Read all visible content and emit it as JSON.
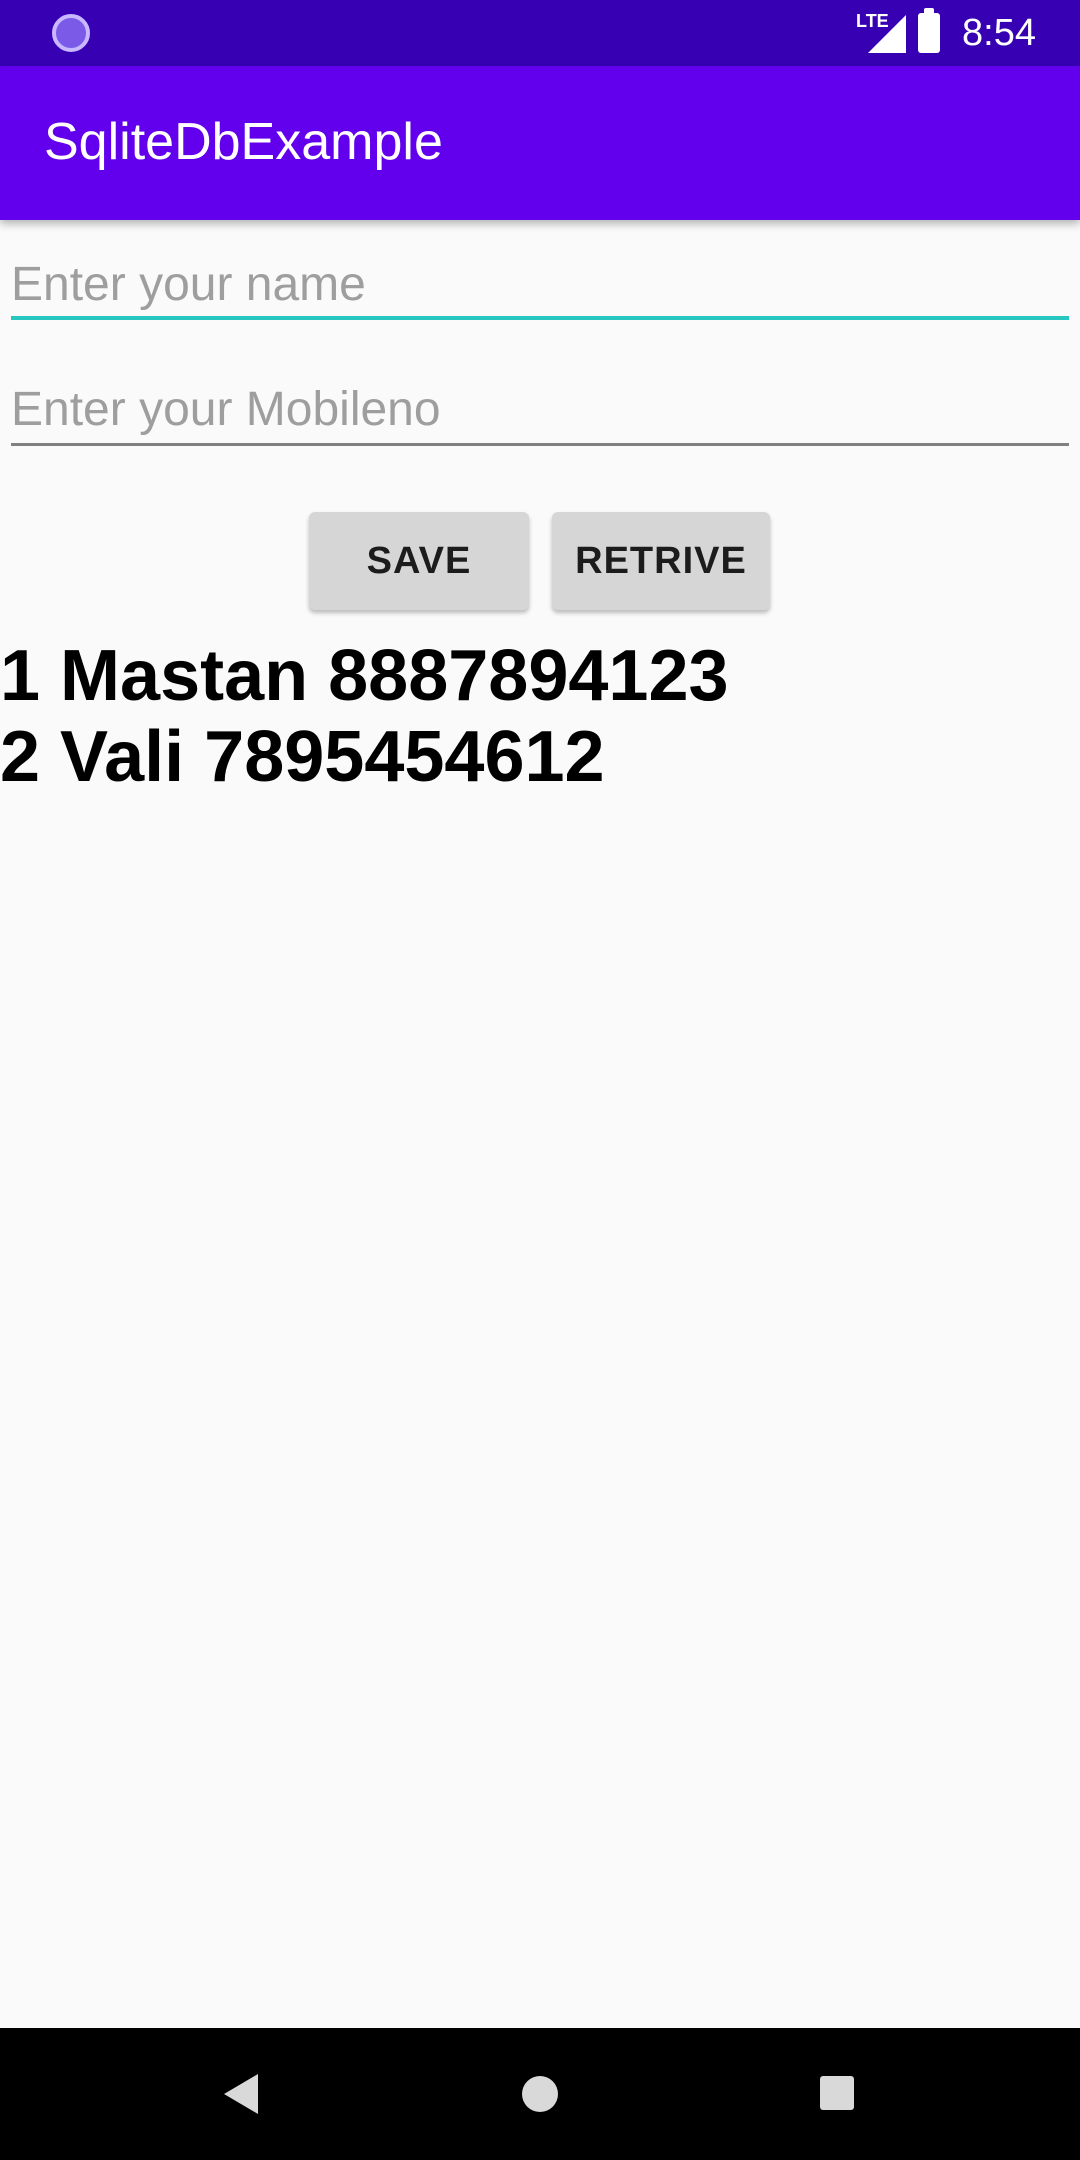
{
  "status_bar": {
    "time": "8:54",
    "network": "LTE",
    "icons": [
      "app-notification-icon",
      "lte-signal-icon",
      "battery-icon"
    ]
  },
  "app_bar": {
    "title": "SqliteDbExample"
  },
  "form": {
    "name_placeholder": "Enter your name",
    "name_value": "",
    "mobile_placeholder": "Enter your Mobileno",
    "mobile_value": ""
  },
  "buttons": {
    "save_label": "SAVE",
    "retrive_label": "RETRIVE"
  },
  "results": [
    "1 Mastan 8887894123",
    "2 Vali 7895454612"
  ],
  "navigation": {
    "icons": [
      "back-icon",
      "home-icon",
      "recents-icon"
    ]
  },
  "colors": {
    "status_bar": "#3700b3",
    "app_bar": "#6200ee",
    "input_focus_underline": "#26c6c1",
    "button_background": "#d6d6d6",
    "background": "#fafafa"
  }
}
